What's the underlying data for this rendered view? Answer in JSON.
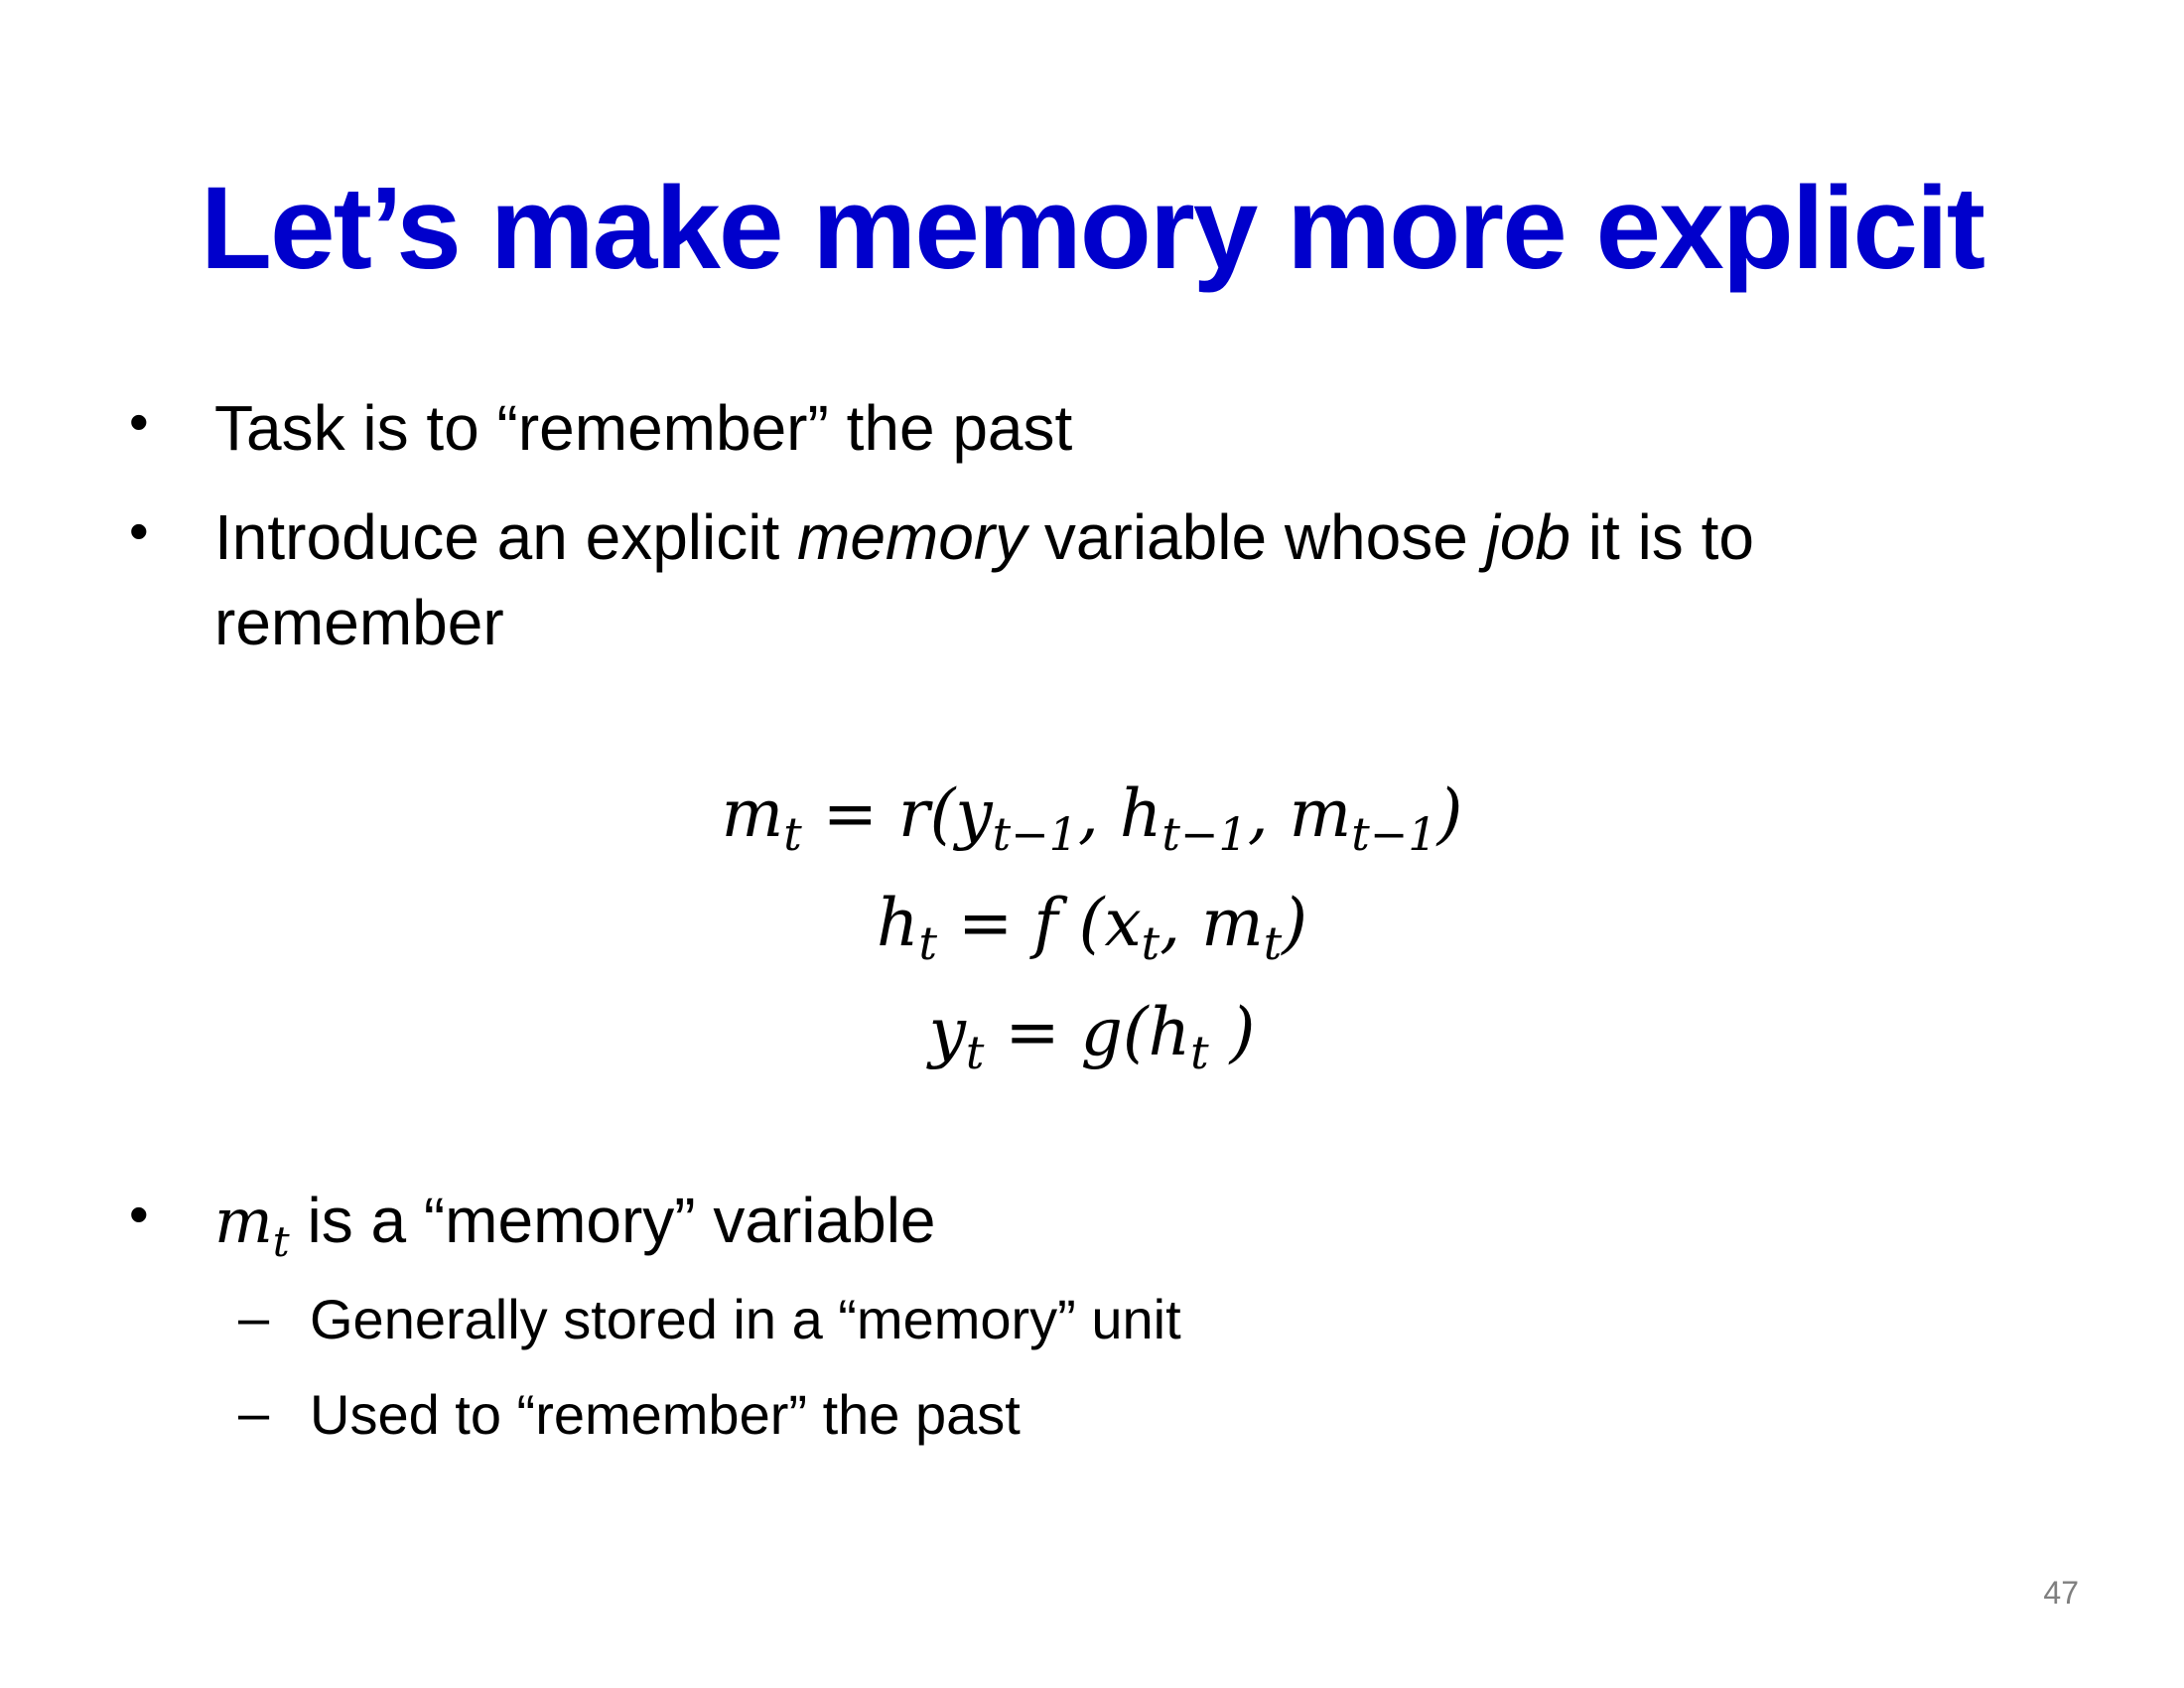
{
  "slide": {
    "title": "Let’s make memory more explicit",
    "title_color": "#0000cc",
    "bullet_char": "•",
    "dash_char": "–",
    "bullets": [
      {
        "text": "Task is to “remember” the past"
      },
      {
        "part1": "Introduce an explicit ",
        "em1": "memory",
        "part2": " variable whose ",
        "em2": "job",
        "part3": " it is to remember"
      },
      {
        "math_var": "m",
        "math_sub": "t",
        "rest": " is a “memory” variable"
      }
    ],
    "sub_bullets": [
      "Generally stored in a “memory” unit",
      "Used to “remember” the past"
    ],
    "equations": [
      {
        "lhs": "m",
        "lhs_sub": "t",
        "eq": " = r(",
        "a1": "y",
        "a1_sub": "t−1",
        "c1": ", ",
        "a2": "h",
        "a2_sub": "t−1",
        "c2": ", ",
        "a3": "m",
        "a3_sub": "t−1",
        "close": ")"
      },
      {
        "lhs": "h",
        "lhs_sub": "t",
        "eq": " = f (",
        "a1": "x",
        "a1_sub": "t",
        "c1": ", ",
        "a2": "m",
        "a2_sub": "t",
        "close": ")"
      },
      {
        "lhs": "y",
        "lhs_sub": "t",
        "eq": " = g(",
        "a1": "h",
        "a1_sub": "t",
        "close": " )"
      }
    ],
    "page_number": "47"
  }
}
